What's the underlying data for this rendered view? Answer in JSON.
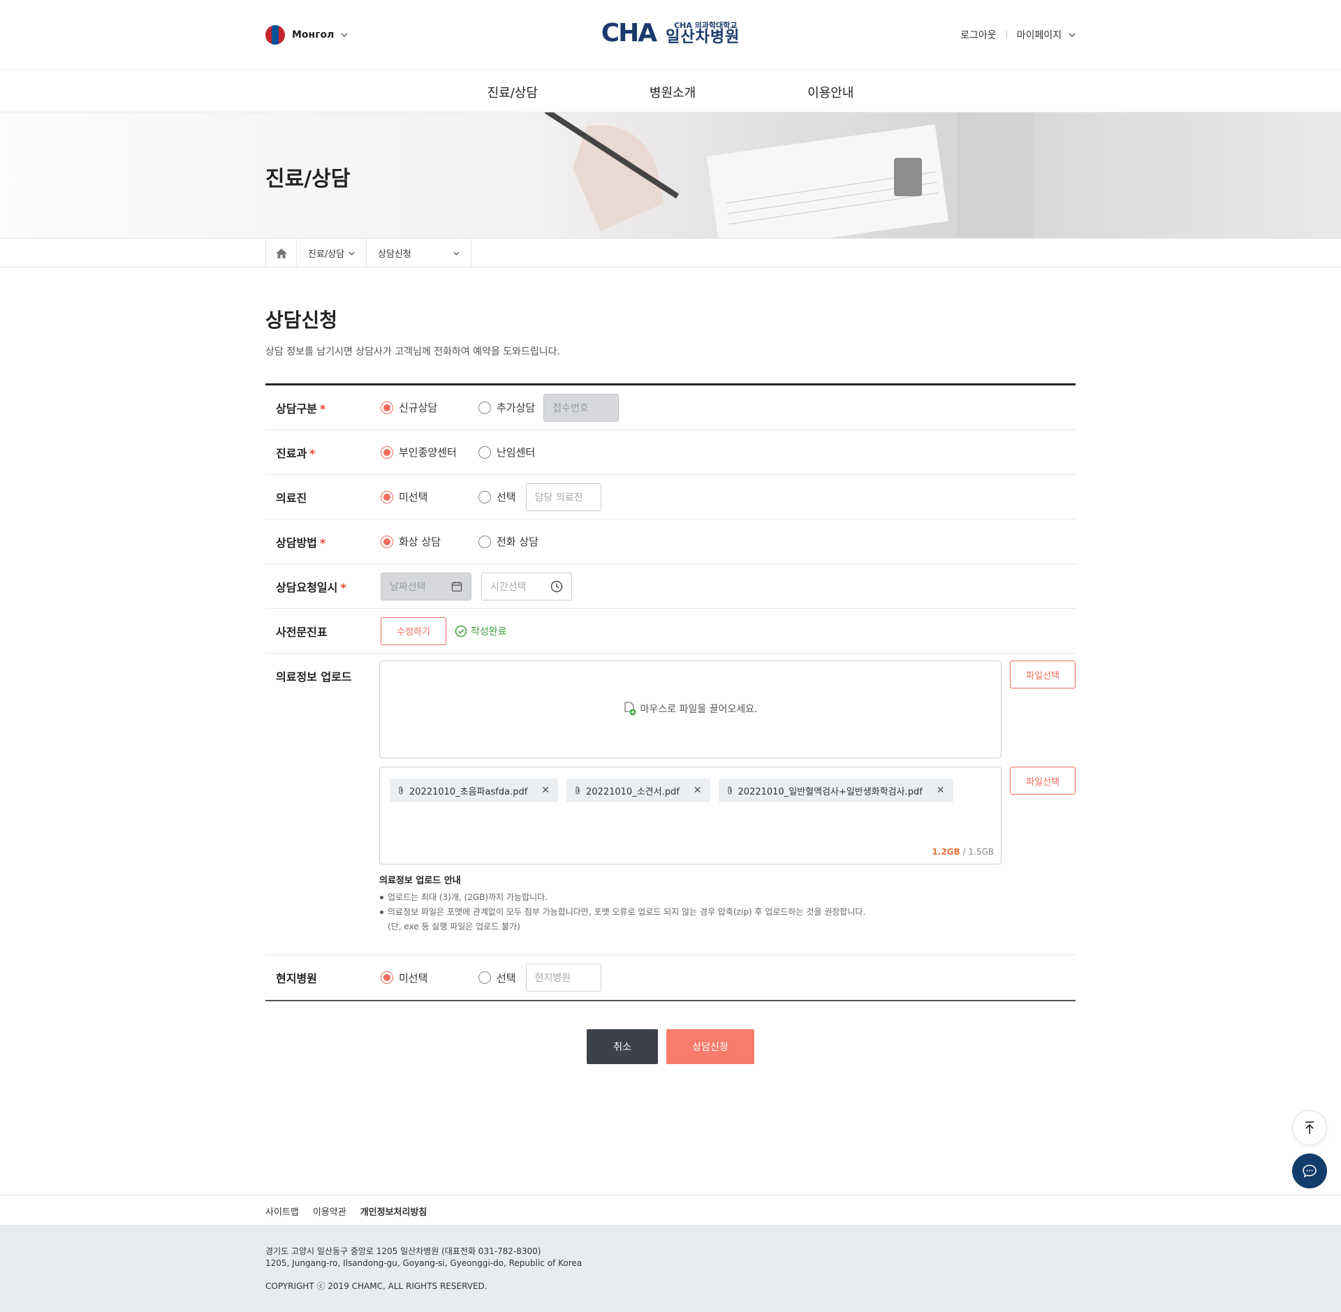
{
  "header": {
    "language": "Монгол",
    "logo_mark": "CHA",
    "logo_sub": "CHA 의과학대학교",
    "logo_main": "일산차병원",
    "logout": "로그아웃",
    "mypage": "마이페이지"
  },
  "nav": {
    "items": [
      "진료/상담",
      "병원소개",
      "이용안내"
    ]
  },
  "hero": {
    "title": "진료/상담"
  },
  "breadcrumb": {
    "level1": "진료/상담",
    "level2": "상담신청"
  },
  "page": {
    "title": "상담신청",
    "description": "상담 정보를 남기시면 상담사가 고객님께 전화하여 예약을 도와드립니다."
  },
  "form": {
    "type": {
      "label": "상담구분",
      "opt1": "신규상담",
      "opt2": "추가상담",
      "receipt_placeholder": "접수번호"
    },
    "dept": {
      "label": "진료과",
      "opt1": "부인종양센터",
      "opt2": "난임센터"
    },
    "doctor": {
      "label": "의료진",
      "opt1": "미선택",
      "opt2": "선택",
      "placeholder": "담당 의료진"
    },
    "method": {
      "label": "상담방법",
      "opt1": "화상 상담",
      "opt2": "전화 상담"
    },
    "datetime": {
      "label": "상담요청일시",
      "date_placeholder": "날짜선택",
      "time_placeholder": "시간선택"
    },
    "questionnaire": {
      "label": "사전문진표",
      "edit": "수정하기",
      "status": "작성완료"
    },
    "upload": {
      "label": "의료정보 업로드",
      "drop_text": "마우스로 파일을 끌어오세요.",
      "select_button": "파일선택",
      "files": [
        "20221010_초음파asfda.pdf",
        "20221010_소견서.pdf",
        "20221010_일반혈액검사+일반생화학검사.pdf"
      ],
      "used": "1.2GB",
      "total": "/ 1.5GB",
      "guide_title": "의료정보 업로드 안내",
      "guide_1": "업로드는 최대 (3)개, (2GB)까지 가능합니다.",
      "guide_2": "의료정보 파일은 포맷에 관계없이 모두 첨부 가능합니다만, 포맷 오류로 업로드 되지 않는 경우 압축(zip) 후 업로드하는 것을 권장합니다.",
      "guide_3": "(단, exe 등 실행 파일은 업로드 불가)"
    },
    "local": {
      "label": "현지병원",
      "opt1": "미선택",
      "opt2": "선택",
      "placeholder": "현지병원"
    }
  },
  "actions": {
    "cancel": "취소",
    "submit": "상담신청"
  },
  "footer": {
    "links": [
      "사이트맵",
      "이용약관",
      "개인정보처리방침"
    ],
    "address_kr": "경기도 고양시 일산동구 중앙로 1205 일산차병원 (대표전화 031-782-8300)",
    "address_en": "1205, Jungang-ro, Ilsandong-gu, Goyang-si, Gyeonggi-do, Republic of Korea",
    "copyright": "COPYRIGHT ⓒ 2019 CHAMC, ALL RIGHTS RESERVED."
  },
  "colors": {
    "accent": "#f36c5c",
    "dark_button": "#3d4148",
    "brand_navy": "#1a3a6b",
    "brand_orange": "#e8733a",
    "done_green": "#3fa33b"
  }
}
